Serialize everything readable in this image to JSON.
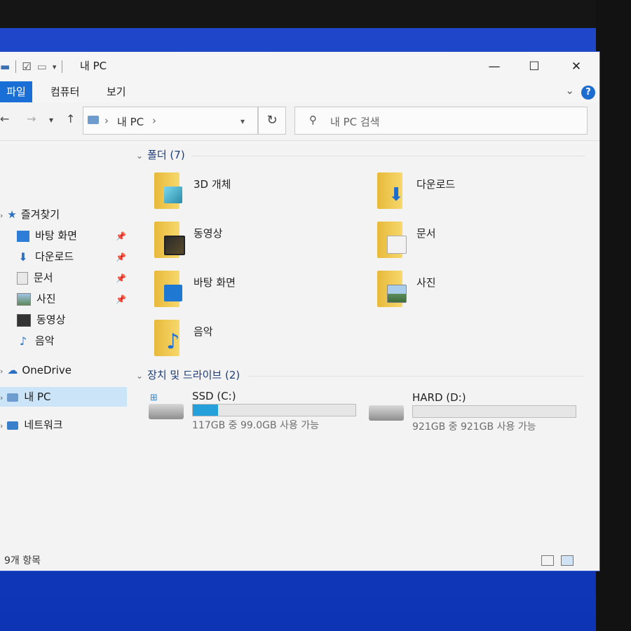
{
  "window": {
    "title": "내 PC",
    "controls": {
      "minimize": "—",
      "maximize": "☐",
      "close": "✕"
    }
  },
  "ribbon": {
    "tabs": [
      "파일",
      "컴퓨터",
      "보기"
    ],
    "help": "?"
  },
  "address": {
    "crumbs": [
      "내 PC"
    ],
    "search_placeholder": "내 PC 검색"
  },
  "sidebar": {
    "quick_access": "즐겨찾기",
    "quick_items": [
      {
        "label": "바탕 화면",
        "icon": "desktop-icon",
        "pinned": true
      },
      {
        "label": "다운로드",
        "icon": "download-icon",
        "pinned": true
      },
      {
        "label": "문서",
        "icon": "documents-icon",
        "pinned": true
      },
      {
        "label": "사진",
        "icon": "pictures-icon",
        "pinned": true
      },
      {
        "label": "동영상",
        "icon": "videos-icon",
        "pinned": false
      },
      {
        "label": "음악",
        "icon": "music-icon",
        "pinned": false
      }
    ],
    "onedrive": "OneDrive",
    "this_pc": "내 PC",
    "network": "네트워크"
  },
  "main": {
    "folders_header": "폴더 (7)",
    "folders": [
      {
        "label": "3D 개체",
        "icon": "3d-objects-icon"
      },
      {
        "label": "다운로드",
        "icon": "downloads-folder-icon"
      },
      {
        "label": "동영상",
        "icon": "videos-folder-icon"
      },
      {
        "label": "문서",
        "icon": "documents-folder-icon"
      },
      {
        "label": "바탕 화면",
        "icon": "desktop-folder-icon"
      },
      {
        "label": "사진",
        "icon": "pictures-folder-icon"
      },
      {
        "label": "음악",
        "icon": "music-folder-icon"
      }
    ],
    "drives_header": "장치 및 드라이브 (2)",
    "drives": [
      {
        "name": "SSD (C:)",
        "free_text": "117GB 중 99.0GB 사용 가능",
        "used_fraction": 0.154
      },
      {
        "name": "HARD (D:)",
        "free_text": "921GB 중 921GB 사용 가능",
        "used_fraction": 0.0
      }
    ]
  },
  "status": {
    "item_count": "9개 항목"
  },
  "colors": {
    "accent": "#1a6fd6",
    "drive_fill": "#26a0da",
    "selection": "#cce4f7"
  }
}
